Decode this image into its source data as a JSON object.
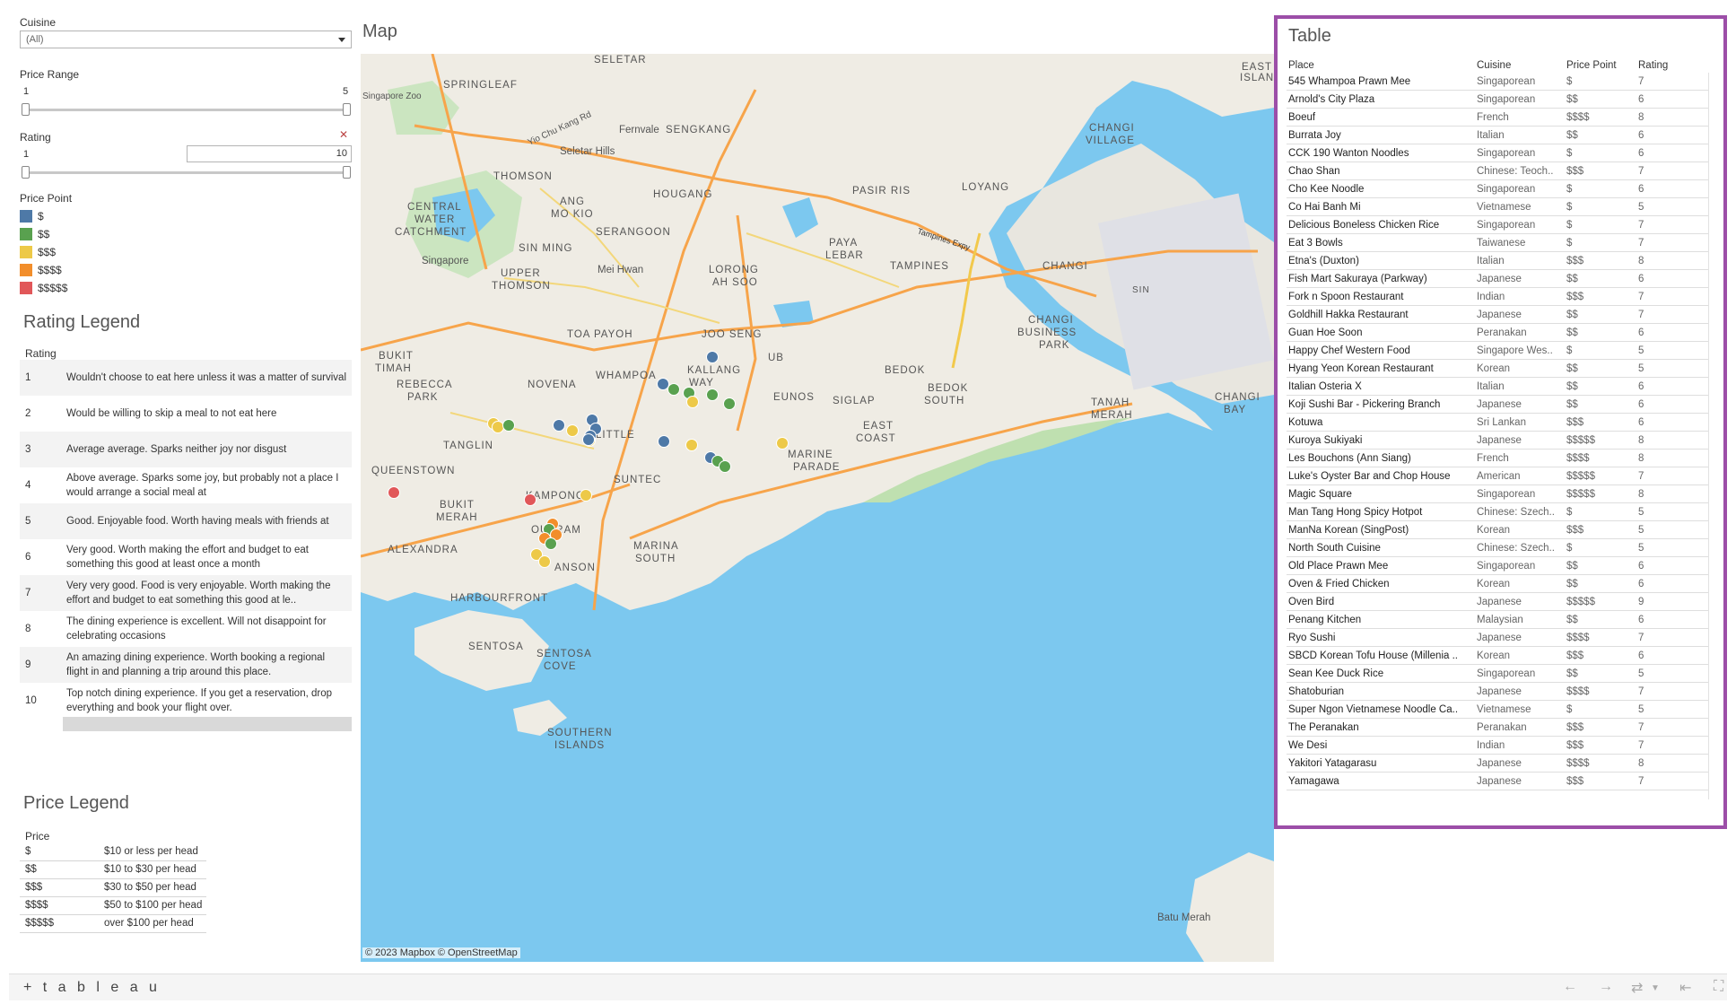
{
  "filters": {
    "cuisine_label": "Cuisine",
    "cuisine_value": "(All)",
    "price_range_label": "Price Range",
    "price_range_min": "1",
    "price_range_max": "5",
    "rating_label": "Rating",
    "rating_min": "1",
    "rating_max": "10",
    "price_point_label": "Price Point",
    "price_points": [
      {
        "label": "$",
        "color": "#4e79a7"
      },
      {
        "label": "$$",
        "color": "#59a14f"
      },
      {
        "label": "$$$",
        "color": "#edc948"
      },
      {
        "label": "$$$$",
        "color": "#f28e2b"
      },
      {
        "label": "$$$$$",
        "color": "#e15759"
      }
    ]
  },
  "rating_legend": {
    "title": "Rating Legend",
    "header": "Rating",
    "rows": [
      {
        "n": "1",
        "text": "Wouldn't choose to eat here unless it was a matter of survival"
      },
      {
        "n": "2",
        "text": "Would be willing to skip a meal to not eat here"
      },
      {
        "n": "3",
        "text": "Average average. Sparks neither joy nor disgust"
      },
      {
        "n": "4",
        "text": "Above average. Sparks some joy, but probably not a place I would arrange a social meal at"
      },
      {
        "n": "5",
        "text": "Good. Enjoyable food. Worth having meals with friends at"
      },
      {
        "n": "6",
        "text": "Very good. Worth making the effort and budget to eat something this good at least once a month"
      },
      {
        "n": "7",
        "text": "Very very good. Food is very enjoyable. Worth making the effort and budget to eat something this good at le.."
      },
      {
        "n": "8",
        "text": "The dining experience is excellent. Will not disappoint for celebrating occasions"
      },
      {
        "n": "9",
        "text": "An amazing dining experience. Worth booking a regional flight in and planning a trip around this place."
      },
      {
        "n": "10",
        "text": "Top notch dining experience. If you get a reservation, drop everything and book your flight over."
      }
    ]
  },
  "price_legend": {
    "title": "Price Legend",
    "header": "Price",
    "rows": [
      {
        "p": "$",
        "d": "$10 or less per head"
      },
      {
        "p": "$$",
        "d": "$10 to $30 per head"
      },
      {
        "p": "$$$",
        "d": "$30 to $50 per head"
      },
      {
        "p": "$$$$",
        "d": "$50 to $100 per head"
      },
      {
        "p": "$$$$$",
        "d": "over $100 per head"
      }
    ]
  },
  "map": {
    "title": "Map",
    "attribution": "© 2023 Mapbox  © OpenStreetMap",
    "labels": [
      "SELETAR",
      "SPRINGLEAF",
      "Singapore Zoo",
      "Yio Chu Kang Rd",
      "Fernvale",
      "SENGKANG",
      "Seletar Hills",
      "THOMSON",
      "CENTRAL WATER CATCHMENT",
      "ANG MO KIO",
      "HOUGANG",
      "SERANGOON",
      "PASIR RIS",
      "LOYANG",
      "CHANGI VILLAGE",
      "SIN MING",
      "Singapore",
      "UPPER THOMSON",
      "Mei Hwan",
      "LORONG AH SOO",
      "PAYA LEBAR",
      "TAMPINES",
      "CHANGI",
      "SIN",
      "TOA PAYOH",
      "JOO SENG",
      "BUKIT TIMAH",
      "NOVENA",
      "WHAMPOA",
      "KALLANG WAY",
      "UB",
      "BEDOK",
      "CHANGI BUSINESS PARK",
      "REBECCA PARK",
      "EUNOS",
      "SIGLAP",
      "BEDOK SOUTH",
      "TANAH MERAH",
      "CHANGI BAY",
      "TANGLIN",
      "LITTLE",
      "EAST COAST",
      "MARINE PARADE",
      "QUEENSTOWN",
      "SUNTEC",
      "KAMPONG",
      "BUKIT MERAH",
      "ALEXANDRA",
      "OUTRAM",
      "MARINA SOUTH",
      "ANSON",
      "HARBOURFRONT",
      "SENTOSA",
      "SENTOSA COVE",
      "SOUTHERN ISLANDS",
      "Batu Merah",
      "EAST ISLAND",
      "Tampines Expy"
    ]
  },
  "table": {
    "title": "Table",
    "headers": [
      "Place",
      "Cuisine",
      "Price Point",
      "Rating"
    ],
    "rows": [
      [
        "545 Whampoa Prawn Mee",
        "Singaporean",
        "$",
        "7"
      ],
      [
        "Arnold's City Plaza",
        "Singaporean",
        "$$",
        "6"
      ],
      [
        "Boeuf",
        "French",
        "$$$$",
        "8"
      ],
      [
        "Burrata Joy",
        "Italian",
        "$$",
        "6"
      ],
      [
        "CCK 190 Wanton Noodles",
        "Singaporean",
        "$",
        "6"
      ],
      [
        "Chao Shan",
        "Chinese: Teoch..",
        "$$$",
        "7"
      ],
      [
        "Cho Kee Noodle",
        "Singaporean",
        "$",
        "6"
      ],
      [
        "Co Hai Banh Mi",
        "Vietnamese",
        "$",
        "5"
      ],
      [
        "Delicious Boneless Chicken Rice",
        "Singaporean",
        "$",
        "7"
      ],
      [
        "Eat 3 Bowls",
        "Taiwanese",
        "$",
        "7"
      ],
      [
        "Etna's (Duxton)",
        "Italian",
        "$$$",
        "8"
      ],
      [
        "Fish Mart Sakuraya (Parkway)",
        "Japanese",
        "$$",
        "6"
      ],
      [
        "Fork n Spoon Restaurant",
        "Indian",
        "$$$",
        "7"
      ],
      [
        "Goldhill Hakka Restaurant",
        "Japanese",
        "$$",
        "7"
      ],
      [
        "Guan Hoe Soon",
        "Peranakan",
        "$$",
        "6"
      ],
      [
        "Happy Chef Western Food",
        "Singapore Wes..",
        "$",
        "5"
      ],
      [
        "Hyang Yeon Korean Restaurant",
        "Korean",
        "$$",
        "5"
      ],
      [
        "Italian Osteria X",
        "Italian",
        "$$",
        "6"
      ],
      [
        "Koji Sushi Bar - Pickering Branch",
        "Japanese",
        "$$",
        "6"
      ],
      [
        "Kotuwa",
        "Sri Lankan",
        "$$$",
        "6"
      ],
      [
        "Kuroya Sukiyaki",
        "Japanese",
        "$$$$$",
        "8"
      ],
      [
        "Les Bouchons (Ann Siang)",
        "French",
        "$$$$",
        "8"
      ],
      [
        "Luke's Oyster Bar and Chop House",
        "American",
        "$$$$$",
        "7"
      ],
      [
        "Magic Square",
        "Singaporean",
        "$$$$$",
        "8"
      ],
      [
        "Man Tang Hong Spicy Hotpot",
        "Chinese: Szech..",
        "$",
        "5"
      ],
      [
        "ManNa Korean (SingPost)",
        "Korean",
        "$$$",
        "5"
      ],
      [
        "North South Cuisine",
        "Chinese: Szech..",
        "$",
        "5"
      ],
      [
        "Old Place Prawn Mee",
        "Singaporean",
        "$$",
        "6"
      ],
      [
        "Oven & Fried Chicken",
        "Korean",
        "$$",
        "6"
      ],
      [
        "Oven Bird",
        "Japanese",
        "$$$$$",
        "9"
      ],
      [
        "Penang Kitchen",
        "Malaysian",
        "$$",
        "6"
      ],
      [
        "Ryo Sushi",
        "Japanese",
        "$$$$",
        "7"
      ],
      [
        "SBCD Korean Tofu House (Millenia ..",
        "Korean",
        "$$$",
        "6"
      ],
      [
        "Sean Kee Duck Rice",
        "Singaporean",
        "$$",
        "5"
      ],
      [
        "Shatoburian",
        "Japanese",
        "$$$$",
        "7"
      ],
      [
        "Super Ngon Vietnamese Noodle Ca..",
        "Vietnamese",
        "$",
        "5"
      ],
      [
        "The Peranakan",
        "Peranakan",
        "$$$",
        "7"
      ],
      [
        "We Desi",
        "Indian",
        "$$$",
        "7"
      ],
      [
        "Yakitori Yatagarasu",
        "Japanese",
        "$$$$",
        "8"
      ],
      [
        "Yamagawa",
        "Japanese",
        "$$$",
        "7"
      ]
    ]
  },
  "footer": {
    "logo": "+ t a b l e a u"
  }
}
